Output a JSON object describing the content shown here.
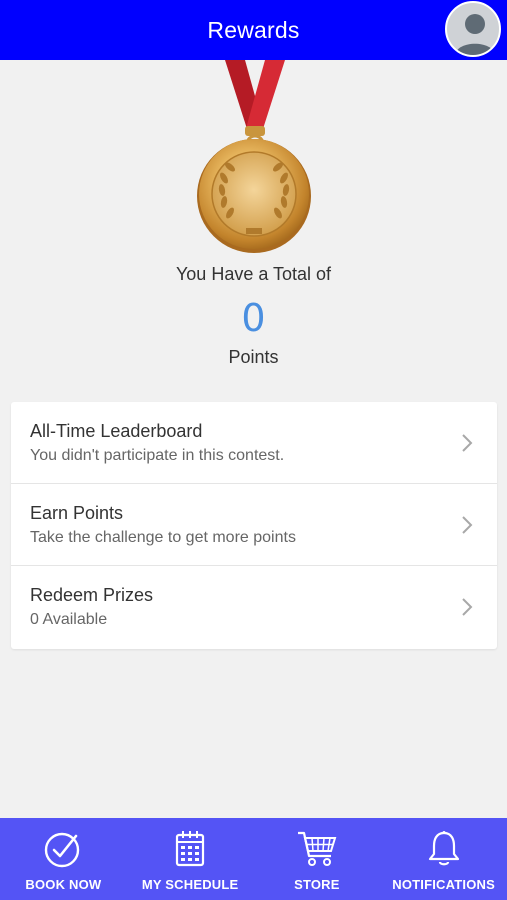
{
  "header": {
    "title": "Rewards"
  },
  "summary": {
    "total_label": "You Have a Total of",
    "points": "0",
    "points_label": "Points"
  },
  "menu": {
    "items": [
      {
        "title": "All-Time Leaderboard",
        "subtitle": "You didn't participate in this contest."
      },
      {
        "title": "Earn Points",
        "subtitle": "Take the challenge to get more points"
      },
      {
        "title": "Redeem Prizes",
        "subtitle": "0 Available"
      }
    ]
  },
  "tabbar": {
    "tabs": [
      {
        "label": "BOOK NOW",
        "icon": "check-circle-icon"
      },
      {
        "label": "MY SCHEDULE",
        "icon": "calendar-icon"
      },
      {
        "label": "STORE",
        "icon": "cart-icon"
      },
      {
        "label": "NOTIFICATIONS",
        "icon": "bell-icon"
      }
    ]
  },
  "colors": {
    "header_bg": "#0000ff",
    "tabbar_bg": "#5454f5",
    "points_accent": "#4a8fe0",
    "medal_gold": "#d9a441",
    "ribbon_red": "#c8202a"
  }
}
